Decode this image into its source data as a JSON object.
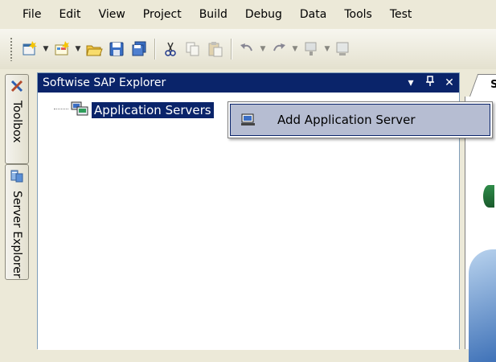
{
  "menubar": {
    "items": [
      "File",
      "Edit",
      "View",
      "Project",
      "Build",
      "Debug",
      "Data",
      "Tools",
      "Test"
    ]
  },
  "side_tabs": {
    "toolbox": "Toolbox",
    "server_explorer": "Server Explorer"
  },
  "panel": {
    "title": "Softwise SAP Explorer",
    "pin_glyph": "↓p",
    "dropdown_glyph": "▾",
    "close_glyph": "✕"
  },
  "tree": {
    "root_label": "Application Servers"
  },
  "context_menu": {
    "items": [
      "Add Application Server"
    ]
  },
  "document_tab": {
    "label": "S"
  },
  "colors": {
    "selection": "#0a246a",
    "menu_highlight": "#b6bdd2",
    "chrome": "#ece9d8"
  }
}
